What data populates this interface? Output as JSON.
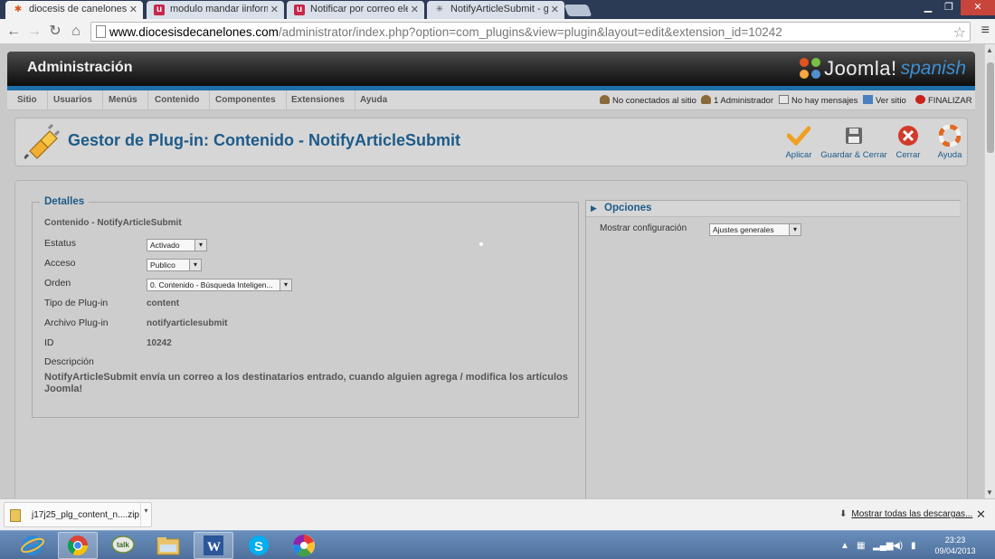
{
  "browser": {
    "tabs": [
      {
        "title": "diocesis de canelones - Ad",
        "fav": "joomla",
        "active": true
      },
      {
        "title": "modulo mandar iinforma",
        "fav": "u",
        "active": false
      },
      {
        "title": "Notificar por correo electr",
        "fav": "u",
        "active": false
      },
      {
        "title": "NotifyArticleSubmit - get",
        "fav": "spark",
        "active": false
      }
    ],
    "url_host": "www.diocesisdecanelones.com",
    "url_path": "/administrator/index.php?option=com_plugins&view=plugin&layout=edit&extension_id=10242"
  },
  "admin": {
    "title": "Administración",
    "logo_word": "Joomla!",
    "logo_lang": "spanish",
    "menu": [
      "Sitio",
      "Usuarios",
      "Menús",
      "Contenido",
      "Componentes",
      "Extensiones",
      "Ayuda"
    ],
    "status": {
      "not_connected": "No conectados al sitio",
      "admins": "1 Administrador",
      "messages": "No hay mensajes",
      "view_site": "Ver sitio",
      "logout": "FINALIZAR"
    }
  },
  "toolbar": {
    "page_title": "Gestor de Plug-in: Contenido - NotifyArticleSubmit",
    "apply": "Aplicar",
    "save_close": "Guardar & Cerrar",
    "close": "Cerrar",
    "help": "Ayuda"
  },
  "details": {
    "legend": "Detalles",
    "subtitle": "Contenido - NotifyArticleSubmit",
    "status_label": "Estatus",
    "status_value": "Activado",
    "access_label": "Acceso",
    "access_value": "Publico",
    "order_label": "Orden",
    "order_value": "0. Contenido - Búsqueda Inteligen...",
    "type_label": "Tipo de Plug-in",
    "type_value": "content",
    "file_label": "Archivo Plug-in",
    "file_value": "notifyarticlesubmit",
    "id_label": "ID",
    "id_value": "10242",
    "desc_label": "Descripción",
    "desc_value": "NotifyArticleSubmit envía un correo a los destinatarios entrado, cuando alguien agrega / modifica los artículos Joomla!"
  },
  "options": {
    "header": "Opciones",
    "show_config_label": "Mostrar configuración",
    "show_config_value": "Ajustes generales"
  },
  "downloads": {
    "file": "j17j25_plg_content_n....zip",
    "show_all": "Mostrar todas las descargas..."
  },
  "taskbar": {
    "time": "23:23",
    "date": "09/04/2013"
  },
  "colors": {
    "joomla_blue": "#1d5b89",
    "stripe_blue": "#1e6fa8",
    "close_red": "#d23b2b",
    "apply_orange": "#f0a020"
  }
}
